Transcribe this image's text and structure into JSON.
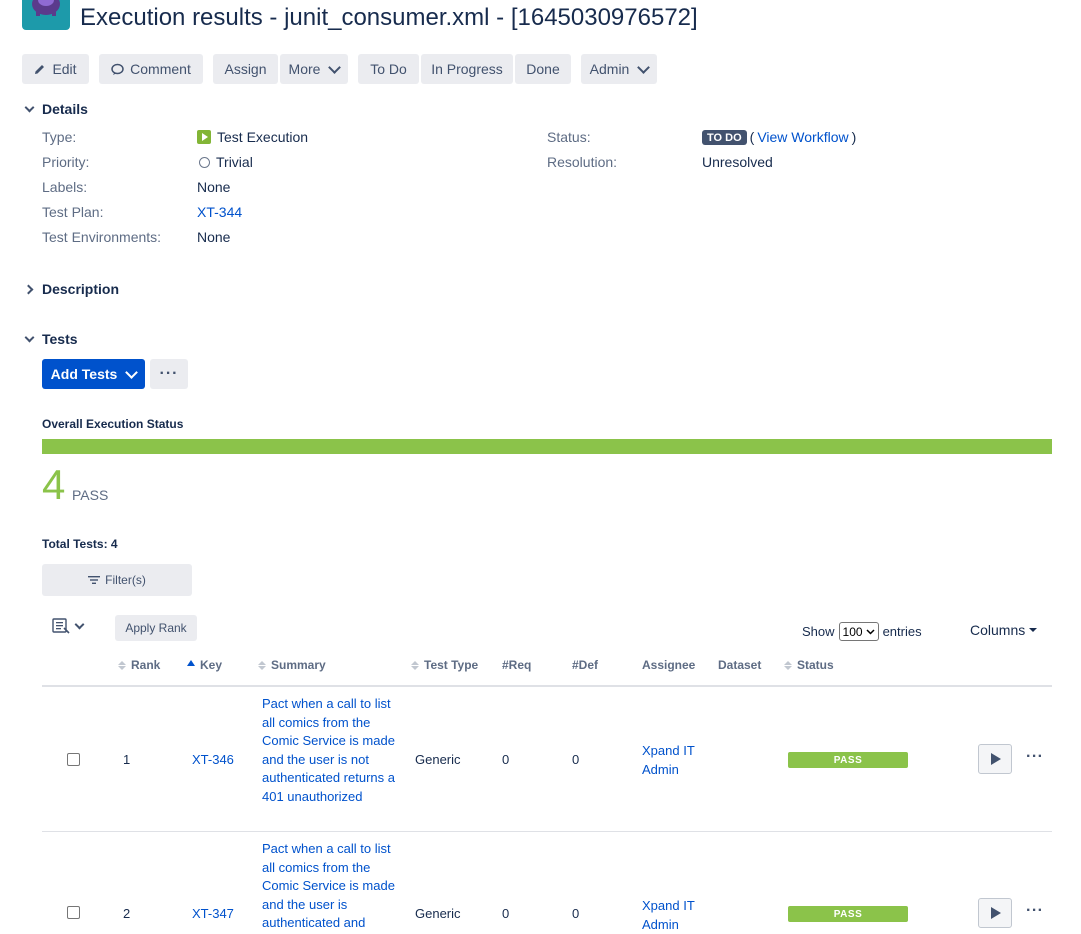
{
  "header": {
    "title": "Execution results - junit_consumer.xml - [1645030976572]"
  },
  "toolbar": {
    "edit": "Edit",
    "comment": "Comment",
    "assign": "Assign",
    "more": "More",
    "todo": "To Do",
    "in_progress": "In Progress",
    "done": "Done",
    "admin": "Admin"
  },
  "details": {
    "section_label": "Details",
    "type_label": "Type:",
    "type_value": "Test Execution",
    "priority_label": "Priority:",
    "priority_value": "Trivial",
    "labels_label": "Labels:",
    "labels_value": "None",
    "test_plan_label": "Test Plan:",
    "test_plan_value": "XT-344",
    "test_env_label": "Test Environments:",
    "test_env_value": "None",
    "status_label": "Status:",
    "status_value": "TO DO",
    "view_workflow_open": "(",
    "view_workflow": "View Workflow",
    "view_workflow_close": ")",
    "resolution_label": "Resolution:",
    "resolution_value": "Unresolved"
  },
  "description": {
    "section_label": "Description"
  },
  "tests": {
    "section_label": "Tests",
    "add_tests": "Add Tests",
    "more_dots": "···",
    "overall_label": "Overall Execution Status",
    "pass_count": "4",
    "pass_label": "PASS",
    "pass_fraction": 1.0,
    "total_tests": "Total Tests: 4",
    "filter_label": "Filter(s)",
    "apply_rank": "Apply Rank",
    "show_label": "Show",
    "entries_value": "100",
    "entries_label": "entries",
    "columns_label": "Columns"
  },
  "table": {
    "headers": {
      "rank": "Rank",
      "key": "Key",
      "summary": "Summary",
      "test_type": "Test Type",
      "req": "#Req",
      "def": "#Def",
      "assignee": "Assignee",
      "dataset": "Dataset",
      "status": "Status"
    },
    "rows": [
      {
        "rank": "1",
        "key": "XT-346",
        "summary": "Pact when a call to list all comics from the Comic Service is made and the user is not authenticated returns a 401 unauthorized",
        "test_type": "Generic",
        "req": "0",
        "def": "0",
        "assignee": "Xpand IT Admin",
        "status": "PASS"
      },
      {
        "rank": "2",
        "key": "XT-347",
        "summary": "Pact when a call to list all comics from the Comic Service is made and the user is authenticated and",
        "test_type": "Generic",
        "req": "0",
        "def": "0",
        "assignee": "Xpand IT Admin",
        "status": "PASS"
      }
    ]
  },
  "colors": {
    "accent": "#0052cc",
    "pass": "#8bc34a",
    "todo_badge": "#42526e"
  }
}
